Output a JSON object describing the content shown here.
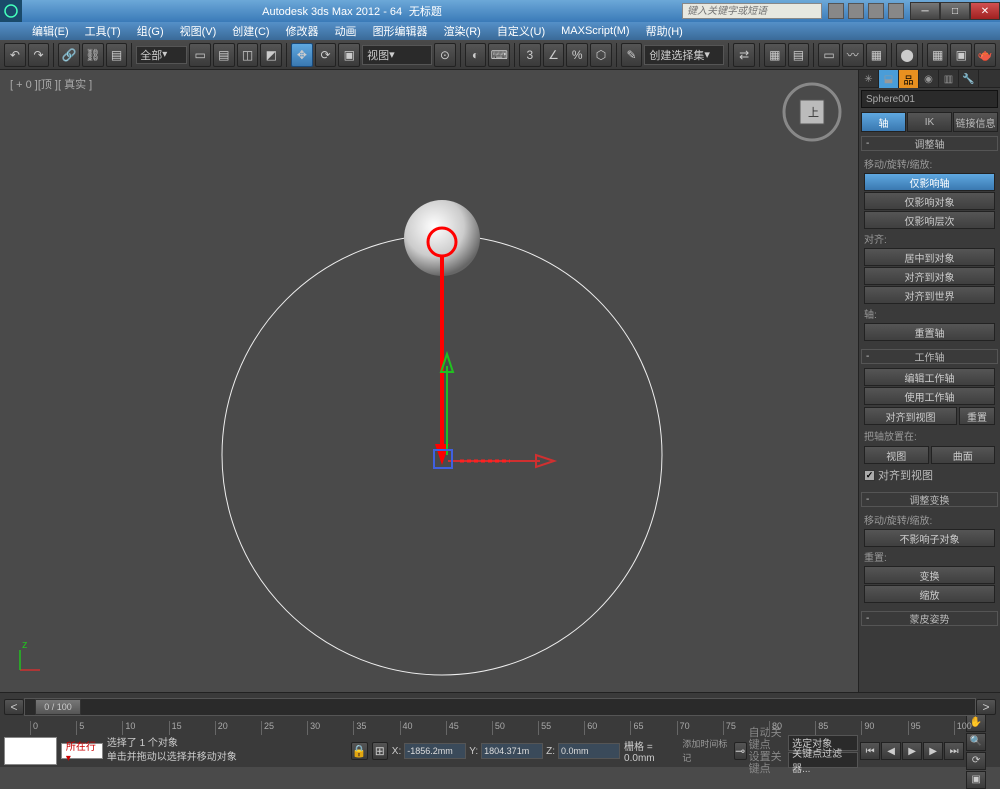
{
  "title": {
    "app": "Autodesk 3ds Max 2012 - 64",
    "document": "无标题",
    "search_placeholder": "键入关键字或短语"
  },
  "menu": [
    "编辑(E)",
    "工具(T)",
    "组(G)",
    "视图(V)",
    "创建(C)",
    "修改器",
    "动画",
    "图形编辑器",
    "渲染(R)",
    "自定义(U)",
    "MAXScript(M)",
    "帮助(H)"
  ],
  "toolbar": {
    "filter": "全部",
    "view": "视图",
    "create_set": "创建选择集"
  },
  "viewport": {
    "label": "[ + 0 ][顶 ][ 真实 ]"
  },
  "panel": {
    "object_name": "Sphere001",
    "tabs": {
      "pivot": "轴",
      "ik": "IK",
      "link": "链接信息"
    },
    "rollouts": {
      "adjust_pivot": {
        "title": "调整轴",
        "move_rot_scale": "移动/旋转/缩放:",
        "affect_pivot": "仅影响轴",
        "affect_object": "仅影响对象",
        "affect_hierarchy": "仅影响层次",
        "align_section": "对齐:",
        "center_to_object": "居中到对象",
        "align_to_object": "对齐到对象",
        "align_to_world": "对齐到世界",
        "pivot_section": "轴:",
        "reset_pivot": "重置轴"
      },
      "working_pivot": {
        "title": "工作轴",
        "edit": "编辑工作轴",
        "use": "使用工作轴",
        "align_to_view": "对齐到视图",
        "reset": "重置",
        "place_label": "把轴放置在:",
        "view_btn": "视图",
        "surface_btn": "曲面",
        "align_view_check": "对齐到视图"
      },
      "adjust_transform": {
        "title": "调整变换",
        "move_rot_scale": "移动/旋转/缩放:",
        "dont_affect_children": "不影响子对象",
        "reset_section": "重置:",
        "transform": "变换",
        "scale": "缩放"
      },
      "skin_pose": {
        "title": "蒙皮姿势"
      }
    }
  },
  "timeline": {
    "slider": "0 / 100",
    "ticks": [
      "0",
      "5",
      "10",
      "15",
      "20",
      "25",
      "30",
      "35",
      "40",
      "45",
      "50",
      "55",
      "60",
      "65",
      "70",
      "75",
      "80",
      "85",
      "90",
      "95",
      "100"
    ]
  },
  "status": {
    "current_tag": "所在行 ▾",
    "line1": "选择了 1 个对象",
    "line2": "单击并拖动以选择并移动对象",
    "add_time_tag": "添加时间标记",
    "coords": {
      "x_label": "X:",
      "x": "-1856.2mm",
      "y_label": "Y:",
      "y": "1804.371m",
      "z_label": "Z:",
      "z": "0.0mm"
    },
    "grid": "栅格 = 0.0mm",
    "auto_key": "自动关键点",
    "set_key": "设置关键点",
    "selected": "选定对象",
    "key_filters": "关键点过滤器..."
  }
}
